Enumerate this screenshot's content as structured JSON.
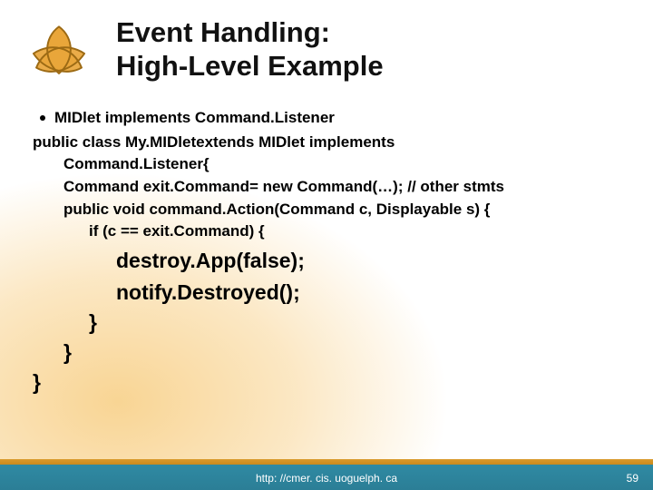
{
  "title": {
    "line1": "Event Handling:",
    "line2": "High-Level Example"
  },
  "bullet": "MIDlet implements Command.Listener",
  "code": {
    "l1": "public class My.MIDletextends MIDlet implements",
    "l2": "Command.Listener{",
    "l3": "Command exit.Command= new Command(…); // other stmts",
    "l4": "public void command.Action(Command c, Displayable s) {",
    "l5": "if (c == exit.Command) {",
    "big1": "destroy.App(false);",
    "big2": "notify.Destroyed();",
    "close3": "}",
    "close2": "}",
    "close1": "}"
  },
  "footer": {
    "url": "http: //cmer. cis. uoguelph. ca",
    "page": "59"
  }
}
